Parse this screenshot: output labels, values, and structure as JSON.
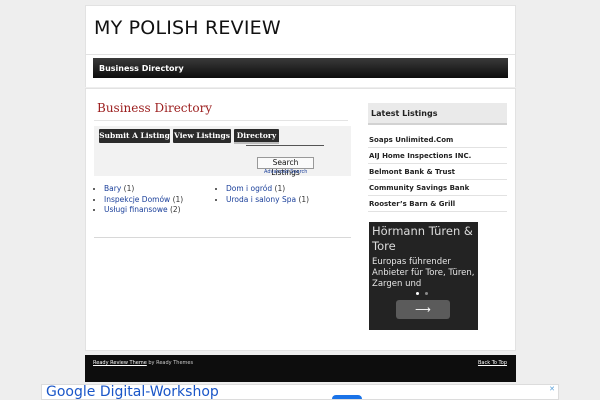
{
  "site": {
    "title": "MY POLISH REVIEW"
  },
  "nav": {
    "items": [
      {
        "label": "Business Directory"
      }
    ]
  },
  "main": {
    "page_title": "Business Directory",
    "buttons": {
      "submit": "Submit A Listing",
      "view": "View Listings",
      "directory": "Directory"
    },
    "search": {
      "button": "Search Listings",
      "advanced": "Advanced Search"
    },
    "categories_col1": [
      {
        "name": "Bary",
        "count": "(1)"
      },
      {
        "name": "Inspekcje Domów",
        "count": "(1)"
      },
      {
        "name": "Usługi finansowe",
        "count": "(2)"
      }
    ],
    "categories_col2": [
      {
        "name": "Dom i ogród",
        "count": "(1)"
      },
      {
        "name": "Uroda i salony Spa",
        "count": "(1)"
      }
    ]
  },
  "sidebar": {
    "heading": "Latest Listings",
    "listings": [
      "Soaps Unlimited.Com",
      "AIJ Home Inspections INC.",
      "Belmont Bank & Trust",
      "Community Savings Bank",
      "Rooster’s Barn & Grill"
    ],
    "ad": {
      "title": "Hörmann Türen & Tore",
      "text": "Europas führender Anbieter für Tore, Türen, Zargen und",
      "arrow": "⟶"
    }
  },
  "footer": {
    "theme_link": "Ready Review Theme",
    "by_text": " by Ready Themes",
    "back_to_top": "Back To Top"
  },
  "bottom_ad": {
    "text": "Google Digital-Workshop",
    "close": "✕"
  },
  "colors": {
    "accent_title": "#9b1c1c",
    "link": "#1a3f9a",
    "dark": "#0d0d0d"
  }
}
